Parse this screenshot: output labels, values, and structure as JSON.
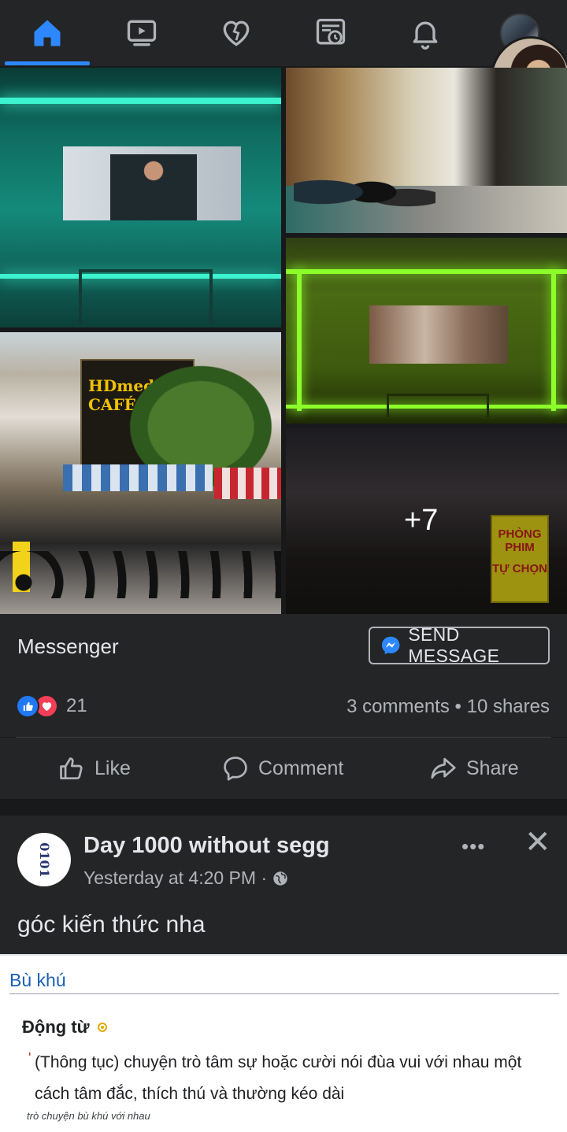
{
  "nav": {
    "items": [
      {
        "name": "home",
        "icon": "home-icon",
        "active": true
      },
      {
        "name": "watch",
        "icon": "video-icon"
      },
      {
        "name": "dating",
        "icon": "heart-icon"
      },
      {
        "name": "memories",
        "icon": "newsfeed-clock-icon"
      },
      {
        "name": "notifications",
        "icon": "bell-icon"
      },
      {
        "name": "profile",
        "icon": "avatar"
      }
    ],
    "active_color": "#2d88ff"
  },
  "gallery": {
    "more_overlay": "+7",
    "photo_texts": {
      "cafe_sign": "HDmedia CAFÉ",
      "room_sign_line1": "PHÒNG PHIM",
      "room_sign_line2": "TỰ CHỌN"
    }
  },
  "messenger_bar": {
    "label": "Messenger",
    "button": "SEND MESSAGE"
  },
  "stats": {
    "reaction_count": "21",
    "comments_shares": "3 comments • 10 shares"
  },
  "actions": {
    "like": "Like",
    "comment": "Comment",
    "share": "Share"
  },
  "post2": {
    "page_name": "Day 1000 without segg",
    "timestamp": "Yesterday at 4:20 PM ·",
    "more": "•••",
    "close": "✕",
    "text": "góc kiến thức nha",
    "avatar_text": "0101"
  },
  "dictionary": {
    "term": "Bù khú",
    "part_of_speech": "Động từ",
    "definition": "(Thông tục) chuyện trò tâm sự hoặc cười nói đùa vui với nhau một cách tâm đắc, thích thú và thường kéo dài",
    "example": "trò chuyện bù khú với nhau"
  },
  "colors": {
    "background": "#18191a",
    "surface": "#242526",
    "text_primary": "#e4e6eb",
    "text_secondary": "#b0b3b8",
    "like_blue": "#2078f4",
    "love_red": "#f33e58"
  }
}
